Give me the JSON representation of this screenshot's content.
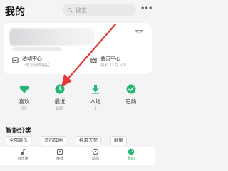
{
  "header": {
    "title": "我的",
    "search_placeholder": "搜索"
  },
  "card": {
    "items": [
      {
        "title": "活动中心",
        "subtitle": "下载复刻赚福钻"
      },
      {
        "title": "会员中心",
        "subtitle": "福利 11月 VIP"
      }
    ]
  },
  "quick": [
    {
      "label": "喜欢",
      "count": "60",
      "icon": "heart-icon"
    },
    {
      "label": "最近",
      "count": "200",
      "icon": "clock-icon"
    },
    {
      "label": "本地",
      "count": "1",
      "icon": "download-icon"
    },
    {
      "label": "已购",
      "count": "",
      "icon": "check-icon"
    }
  ],
  "section": {
    "title": "智能分类"
  },
  "chips": [
    "全部音乐",
    "流行阵地",
    "摇滚天堂",
    "翻唱"
  ],
  "tabs": [
    {
      "label": "音乐馆",
      "icon": "music-note-icon"
    },
    {
      "label": "推荐",
      "icon": "recommend-icon"
    },
    {
      "label": "动态",
      "icon": "feed-icon"
    },
    {
      "label": "我的",
      "icon": "profile-icon"
    }
  ],
  "colors": {
    "accent": "#22b573",
    "annotation": "#e53935"
  }
}
